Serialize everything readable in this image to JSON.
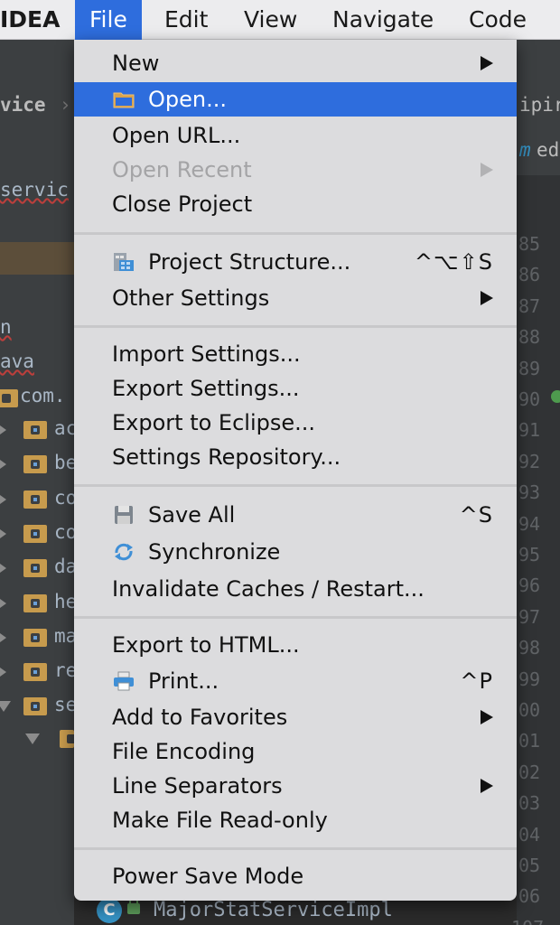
{
  "menubar": {
    "app_name": "IDEA",
    "items": [
      "File",
      "Edit",
      "View",
      "Navigate",
      "Code"
    ]
  },
  "background": {
    "breadcrumb_left": "vice",
    "breadcrumb_right": "ipir",
    "tab_right": "ed",
    "tree_root": "servic",
    "tree_lines": [
      "n",
      "ava",
      "com."
    ],
    "package_stubs": [
      "ac",
      "be",
      "co",
      "co",
      "da",
      "he",
      "ma",
      "re",
      "se"
    ],
    "line_numbers": [
      "85",
      "86",
      "87",
      "88",
      "89",
      "90",
      "91",
      "92",
      "93",
      "94",
      "95",
      "96",
      "97",
      "98",
      "99",
      "00",
      "01",
      "02",
      "03",
      "04",
      "05",
      "06",
      "107"
    ],
    "bottom_class": "MajorStatServiceImpl"
  },
  "file_menu": {
    "items": {
      "new": {
        "label": "New"
      },
      "open": {
        "label": "Open..."
      },
      "open_url": {
        "label": "Open URL..."
      },
      "open_recent": {
        "label": "Open Recent"
      },
      "close_project": {
        "label": "Close Project"
      },
      "project_structure": {
        "label": "Project Structure...",
        "shortcut": "^⌥⇧S"
      },
      "other_settings": {
        "label": "Other Settings"
      },
      "import_settings": {
        "label": "Import Settings..."
      },
      "export_settings": {
        "label": "Export Settings..."
      },
      "export_eclipse": {
        "label": "Export to Eclipse..."
      },
      "settings_repository": {
        "label": "Settings Repository..."
      },
      "save_all": {
        "label": "Save All",
        "shortcut": "^S"
      },
      "synchronize": {
        "label": "Synchronize"
      },
      "invalidate_caches": {
        "label": "Invalidate Caches / Restart..."
      },
      "export_html": {
        "label": "Export to HTML..."
      },
      "print": {
        "label": "Print...",
        "shortcut": "^P"
      },
      "add_favorites": {
        "label": "Add to Favorites"
      },
      "file_encoding": {
        "label": "File Encoding"
      },
      "line_separators": {
        "label": "Line Separators"
      },
      "make_read_only": {
        "label": "Make File Read-only"
      },
      "power_save": {
        "label": "Power Save Mode"
      }
    }
  },
  "colors": {
    "highlight": "#2e6ddd",
    "menu_background": "#dcdcde",
    "disabled_text": "#a4a4a6",
    "ide_background": "#2b2b2b"
  }
}
